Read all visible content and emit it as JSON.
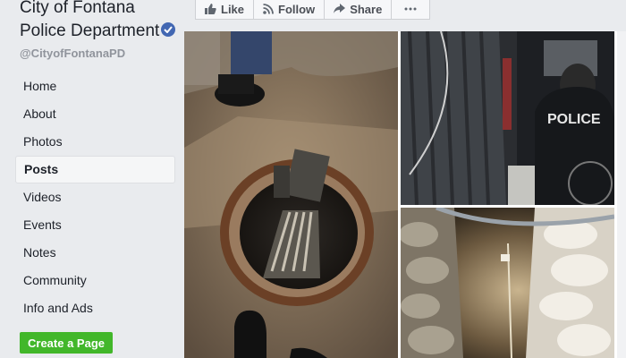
{
  "page": {
    "name": "City of Fontana Police Department",
    "handle": "@CityofFontanaPD"
  },
  "nav": {
    "items": [
      {
        "label": "Home"
      },
      {
        "label": "About"
      },
      {
        "label": "Photos"
      },
      {
        "label": "Posts"
      },
      {
        "label": "Videos"
      },
      {
        "label": "Events"
      },
      {
        "label": "Notes"
      },
      {
        "label": "Community"
      },
      {
        "label": "Info and Ads"
      }
    ],
    "active": "Posts"
  },
  "create_page": {
    "label": "Create a Page"
  },
  "actions": {
    "like": "Like",
    "follow": "Follow",
    "share": "Share"
  },
  "photos": {
    "badge_text": "POLICE"
  },
  "colors": {
    "sidebar_bg": "#e9ebee",
    "create_button": "#42b72a",
    "verified": "#4267b2"
  }
}
